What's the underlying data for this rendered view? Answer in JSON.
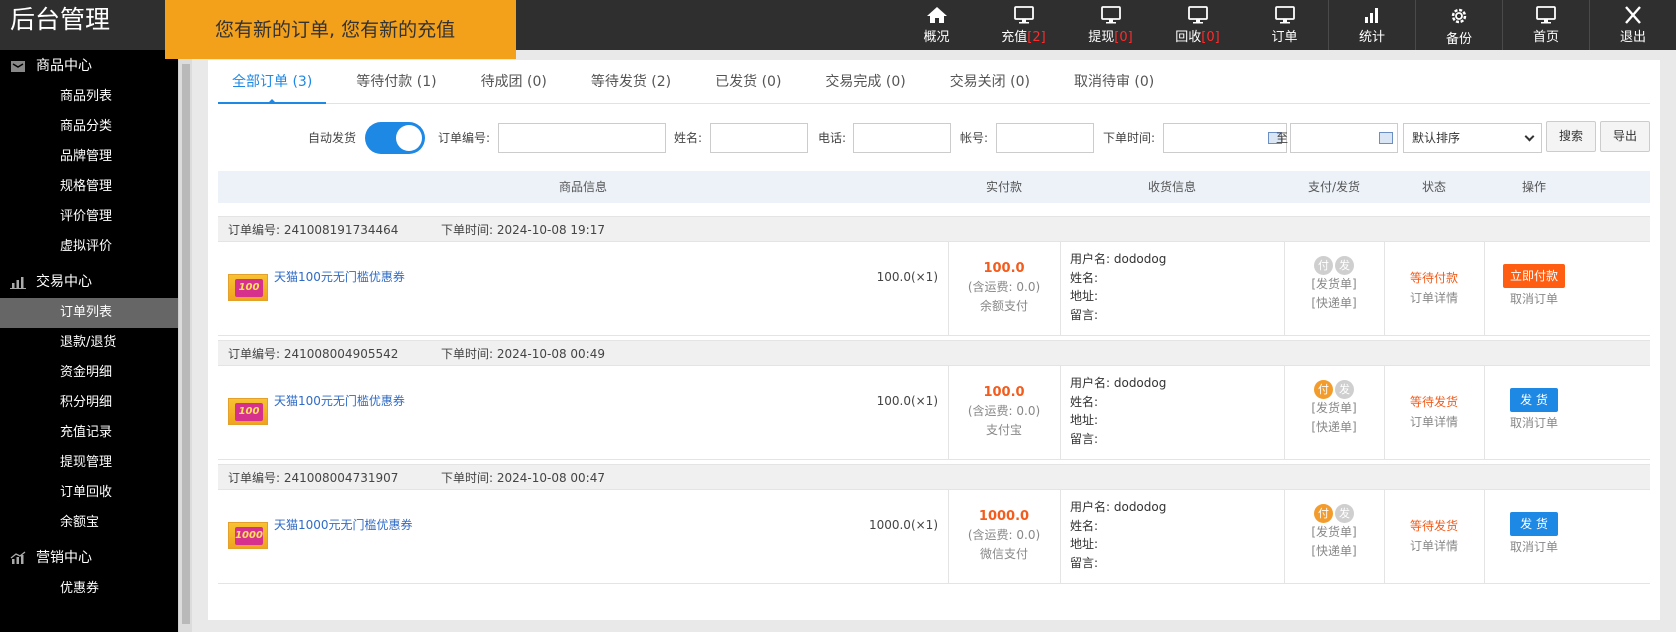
{
  "app": {
    "title": "后台管理",
    "notice": "您有新的订单, 您有新的充值"
  },
  "topnav": [
    {
      "name": "nav-overview",
      "icon": "home-icon",
      "label": "概况",
      "badge": ""
    },
    {
      "name": "nav-recharge",
      "icon": "monitor-icon",
      "label": "充值",
      "badge": "[2]"
    },
    {
      "name": "nav-withdraw",
      "icon": "monitor-icon",
      "label": "提现",
      "badge": "[0]"
    },
    {
      "name": "nav-recycle",
      "icon": "monitor-icon",
      "label": "回收",
      "badge": "[0]"
    },
    {
      "name": "nav-orders",
      "icon": "monitor-icon",
      "label": "订单",
      "badge": ""
    },
    {
      "name": "nav-stats",
      "icon": "bar-chart-icon",
      "label": "统计",
      "badge": ""
    },
    {
      "name": "nav-backup",
      "icon": "gear-icon",
      "label": "备份",
      "badge": ""
    },
    {
      "name": "nav-home",
      "icon": "monitor-icon",
      "label": "首页",
      "badge": ""
    },
    {
      "name": "nav-logout",
      "icon": "close-icon",
      "label": "退出",
      "badge": ""
    }
  ],
  "sidebar": {
    "sections": [
      {
        "title": "商品中心",
        "icon": "box-icon",
        "items": [
          "商品列表",
          "商品分类",
          "品牌管理",
          "规格管理",
          "评价管理",
          "虚拟评价"
        ]
      },
      {
        "title": "交易中心",
        "icon": "bar-chart-icon",
        "items": [
          "订单列表",
          "退款/退货",
          "资金明细",
          "积分明细",
          "充值记录",
          "提现管理",
          "订单回收",
          "余额宝"
        ]
      },
      {
        "title": "营销中心",
        "icon": "line-chart-icon",
        "items": [
          "优惠券"
        ]
      }
    ],
    "active_item": "订单列表"
  },
  "tabs": [
    "全部订单 (3)",
    "等待付款 (1)",
    "待成团 (0)",
    "等待发货 (2)",
    "已发货 (0)",
    "交易完成 (0)",
    "交易关闭 (0)",
    "取消待审 (0)"
  ],
  "filters": {
    "auto_ship_label": "自动发货",
    "auto_ship_on": true,
    "order_no_label": "订单编号:",
    "name_label": "姓名:",
    "phone_label": "电话:",
    "account_label": "帐号:",
    "time_label": "下单时间:",
    "to_label": "至",
    "sort_value": "默认排序",
    "search_label": "搜索",
    "export_label": "导出"
  },
  "table_headers": [
    "商品信息",
    "实付款",
    "收货信息",
    "支付/发货",
    "状态",
    "操作"
  ],
  "orders": [
    {
      "no_label": "订单编号: 241008191734464",
      "time_label": "下单时间: 2024-10-08 19:17",
      "product": "天猫100元无门槛优惠券",
      "thumb_text": "100",
      "qty": "100.0(×1)",
      "amount": "100.0",
      "shipping": "(含运费: 0.0)",
      "method": "余额支付",
      "user": "用户名: dododog",
      "name": "姓名:",
      "addr": "地址:",
      "msg": "留言:",
      "pay_mark": "付",
      "ship_mark": "发",
      "paid": false,
      "ship_note": "[发货单]",
      "express_note": "[快递单]",
      "status": "等待付款",
      "detail": "订单详情",
      "action": "立即付款",
      "action_type": "red",
      "cancel": "取消订单"
    },
    {
      "no_label": "订单编号: 241008004905542",
      "time_label": "下单时间: 2024-10-08 00:49",
      "product": "天猫100元无门槛优惠券",
      "thumb_text": "100",
      "qty": "100.0(×1)",
      "amount": "100.0",
      "shipping": "(含运费: 0.0)",
      "method": "支付宝",
      "user": "用户名: dododog",
      "name": "姓名:",
      "addr": "地址:",
      "msg": "留言:",
      "pay_mark": "付",
      "ship_mark": "发",
      "paid": true,
      "ship_note": "[发货单]",
      "express_note": "[快递单]",
      "status": "等待发货",
      "detail": "订单详情",
      "action": "发 货",
      "action_type": "blue",
      "cancel": "取消订单"
    },
    {
      "no_label": "订单编号: 241008004731907",
      "time_label": "下单时间: 2024-10-08 00:47",
      "product": "天猫1000元无门槛优惠券",
      "thumb_text": "1000",
      "qty": "1000.0(×1)",
      "amount": "1000.0",
      "shipping": "(含运费: 0.0)",
      "method": "微信支付",
      "user": "用户名: dododog",
      "name": "姓名:",
      "addr": "地址:",
      "msg": "留言:",
      "pay_mark": "付",
      "ship_mark": "发",
      "paid": true,
      "ship_note": "[发货单]",
      "express_note": "[快递单]",
      "status": "等待发货",
      "detail": "订单详情",
      "action": "发 货",
      "action_type": "blue",
      "cancel": "取消订单"
    }
  ],
  "colors": {
    "accent": "#1e88e5",
    "notice_bg": "#f3a01b",
    "warn": "#f35c1c",
    "topbar": "#2f2f2f"
  }
}
